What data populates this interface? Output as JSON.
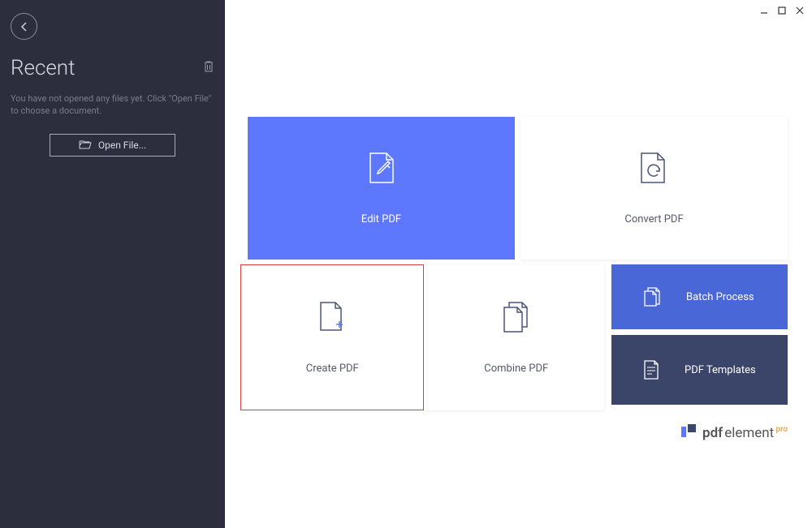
{
  "sidebar": {
    "title": "Recent",
    "message": "You have not opened any files yet. Click \"Open File\" to choose a document.",
    "open_file_label": "Open File..."
  },
  "cards": {
    "edit": "Edit PDF",
    "convert": "Convert PDF",
    "create": "Create PDF",
    "combine": "Combine PDF",
    "batch": "Batch Process",
    "templates": "PDF Templates"
  },
  "logo": {
    "prefix": "pdf",
    "suffix": "element",
    "badge": "pro"
  },
  "colors": {
    "sidebar_bg": "#2c2e3e",
    "primary": "#5d78fc",
    "batch": "#4a67d8",
    "templates": "#3a4569",
    "highlight_border": "#d84040",
    "pro_badge": "#e8a74a"
  }
}
